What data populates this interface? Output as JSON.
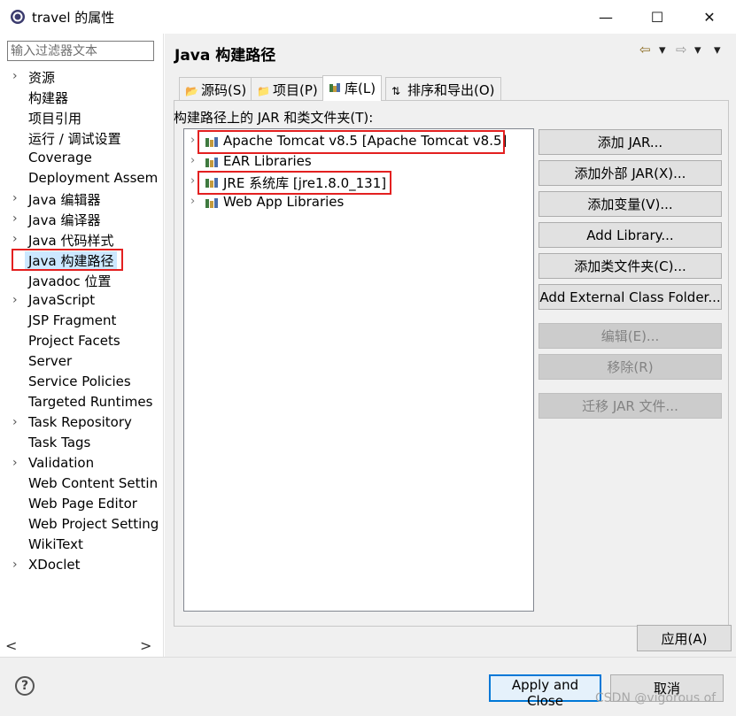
{
  "window": {
    "title": "travel 的属性",
    "controls": [
      "—",
      "☐",
      "✕"
    ]
  },
  "filter": {
    "placeholder": "输入过滤器文本",
    "value": ""
  },
  "nav": {
    "items": [
      {
        "label": "资源",
        "expandable": true
      },
      {
        "label": "构建器",
        "expandable": false
      },
      {
        "label": "项目引用",
        "expandable": false
      },
      {
        "label": "运行 / 调试设置",
        "expandable": false
      },
      {
        "label": "Coverage",
        "expandable": false
      },
      {
        "label": "Deployment Assem",
        "expandable": false
      },
      {
        "label": "Java 编辑器",
        "expandable": true
      },
      {
        "label": "Java 编译器",
        "expandable": true
      },
      {
        "label": "Java 代码样式",
        "expandable": true
      },
      {
        "label": "Java 构建路径",
        "expandable": false,
        "selected": true
      },
      {
        "label": "Javadoc 位置",
        "expandable": false
      },
      {
        "label": "JavaScript",
        "expandable": true
      },
      {
        "label": "JSP Fragment",
        "expandable": false
      },
      {
        "label": "Project Facets",
        "expandable": false
      },
      {
        "label": "Server",
        "expandable": false
      },
      {
        "label": "Service Policies",
        "expandable": false
      },
      {
        "label": "Targeted Runtimes",
        "expandable": false
      },
      {
        "label": "Task Repository",
        "expandable": true
      },
      {
        "label": "Task Tags",
        "expandable": false
      },
      {
        "label": "Validation",
        "expandable": true
      },
      {
        "label": "Web Content Settin",
        "expandable": false
      },
      {
        "label": "Web Page Editor",
        "expandable": false
      },
      {
        "label": "Web Project Setting",
        "expandable": false
      },
      {
        "label": "WikiText",
        "expandable": false
      },
      {
        "label": "XDoclet",
        "expandable": true
      }
    ],
    "scroll_left": "<",
    "scroll_right": ">"
  },
  "panel": {
    "title": "Java 构建路径",
    "back_icon": "⇦",
    "forward_icon": "⇨",
    "dropdown_icon": "▾",
    "tabs": [
      {
        "label": "源码(S)",
        "icon": "source-folder-icon",
        "active": false
      },
      {
        "label": "项目(P)",
        "icon": "project-icon",
        "active": false
      },
      {
        "label": "库(L)",
        "icon": "library-icon",
        "active": true
      },
      {
        "label": "排序和导出(O)",
        "icon": "order-export-icon",
        "active": false
      }
    ],
    "heading": "构建路径上的 JAR 和类文件夹(T):",
    "libraries": [
      {
        "label": "Apache Tomcat v8.5 [Apache Tomcat v8.5]",
        "highlighted": true
      },
      {
        "label": "EAR Libraries",
        "highlighted": false
      },
      {
        "label": "JRE 系统库 [jre1.8.0_131]",
        "highlighted": true
      },
      {
        "label": "Web App Libraries",
        "highlighted": false
      }
    ],
    "buttons": [
      {
        "label": "添加 JAR...",
        "enabled": true
      },
      {
        "label": "添加外部 JAR(X)...",
        "enabled": true
      },
      {
        "label": "添加变量(V)...",
        "enabled": true
      },
      {
        "label": "Add Library...",
        "enabled": true
      },
      {
        "label": "添加类文件夹(C)...",
        "enabled": true
      },
      {
        "label": "Add External Class Folder...",
        "enabled": true
      },
      {
        "label": "编辑(E)...",
        "enabled": false
      },
      {
        "label": "移除(R)",
        "enabled": false
      },
      {
        "label": "迁移 JAR 文件...",
        "enabled": false
      }
    ],
    "apply_label": "应用(A)"
  },
  "footer": {
    "help": "?",
    "apply_close_label": "Apply and Close",
    "cancel_label": "取消",
    "watermark": "CSDN @vigorous of"
  },
  "colors": {
    "highlight_border": "#e32020",
    "selection": "#cce8ff",
    "default_button_border": "#0078d7"
  }
}
